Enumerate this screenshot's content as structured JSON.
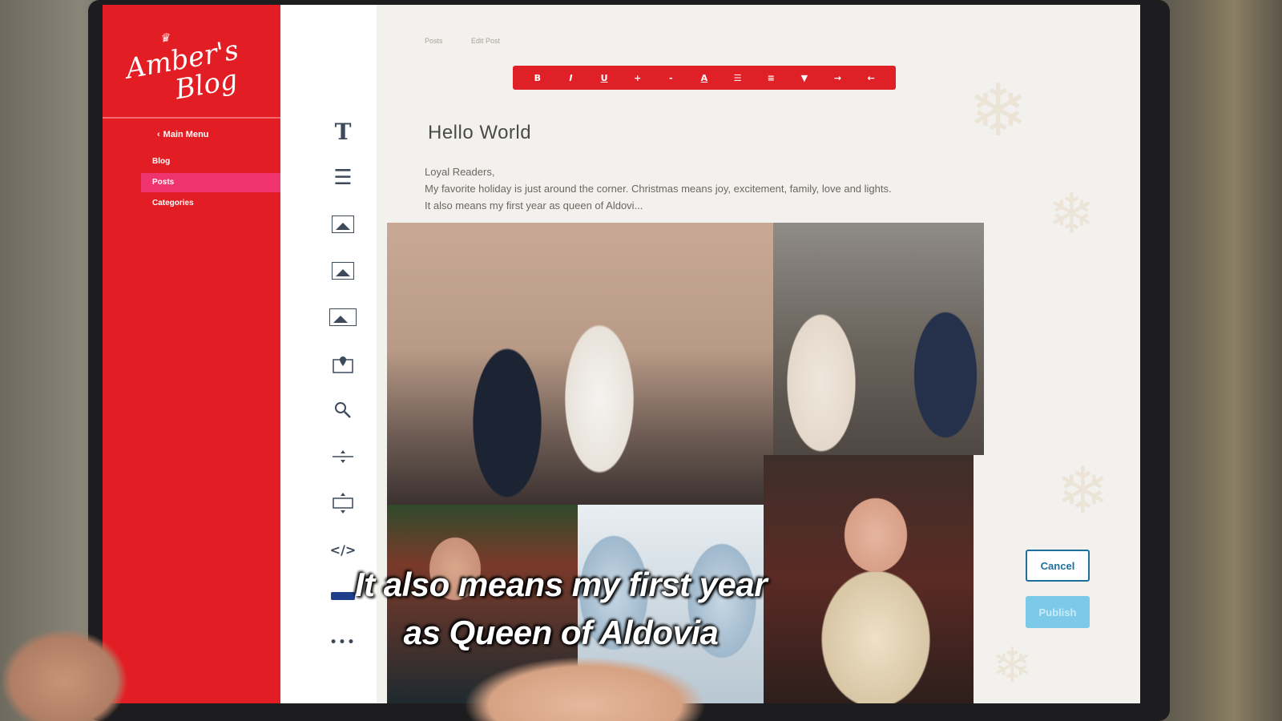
{
  "sidebar": {
    "logo_line1": "Amber's",
    "logo_line2": "Blog",
    "back_label": "Main Menu",
    "items": [
      {
        "label": "Blog"
      },
      {
        "label": "Posts"
      },
      {
        "label": "Categories"
      }
    ],
    "active_item": "Posts"
  },
  "breadcrumb": {
    "posts": "Posts",
    "edit_post": "Edit Post"
  },
  "toolbar": {
    "bold": "B",
    "italic": "I",
    "underline": "U",
    "plus": "+",
    "minus": "-",
    "font_color": "A",
    "list": "☰",
    "align": "≡",
    "dropdown": "▼",
    "indent": "→",
    "outdent": "←"
  },
  "tools": {
    "text": "T",
    "paragraph": "☰",
    "code": "</>",
    "more": "•••"
  },
  "post": {
    "title": "Hello World",
    "greeting": "Loyal Readers,",
    "line1": "My favorite holiday is just around the corner. Christmas means joy, excitement, family, love and lights.",
    "line2": "It also means my first year as queen of Aldovi..."
  },
  "buttons": {
    "cancel": "Cancel",
    "publish": "Publish"
  },
  "subtitle": {
    "line1": "It also means my first year",
    "line2": "as Queen of Aldovia"
  },
  "colors": {
    "sidebar_red": "#e31d24",
    "active_pink": "#f0346f",
    "toolbar_red": "#df2027",
    "cancel_blue": "#1f6f9c",
    "publish_blue": "#7cc9ea"
  }
}
